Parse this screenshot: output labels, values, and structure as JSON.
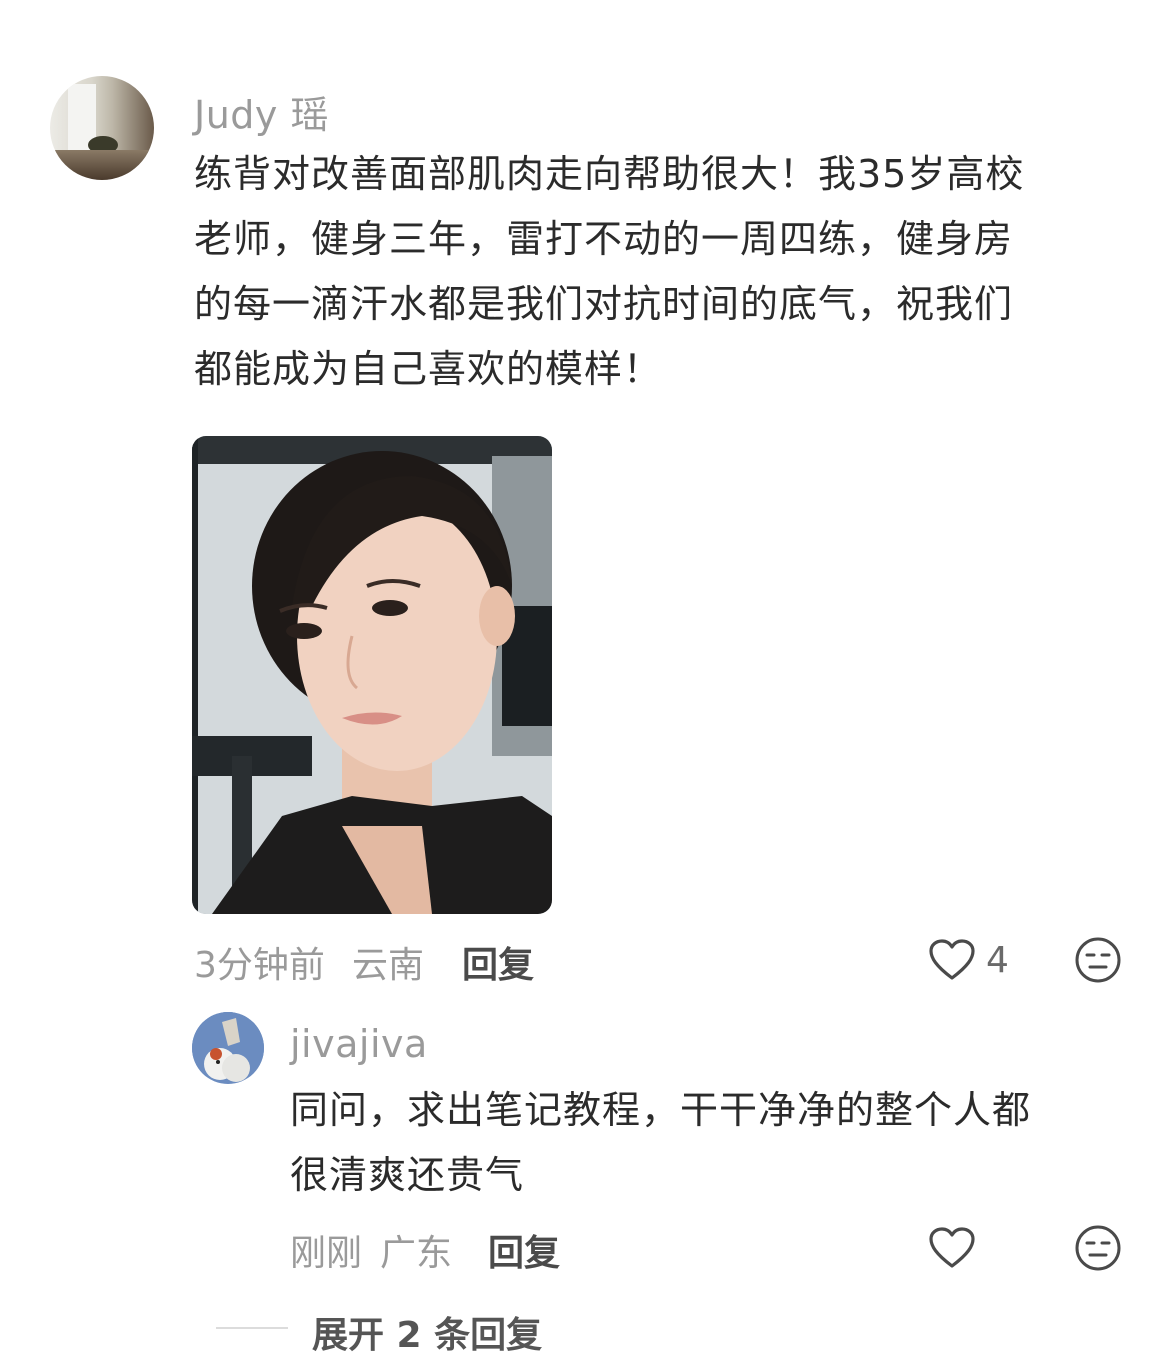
{
  "comment": {
    "username": "Judy 瑶",
    "text_lines": [
      "练背对改善面部肌肉走向帮助很大！我35岁高校",
      "老师，健身三年，雷打不动的一周四练，健身房",
      "的每一滴汗水都是我们对抗时间的底气，祝我们",
      "都能成为自己喜欢的模样！"
    ],
    "time": "3分钟前",
    "location": "云南",
    "reply_label": "回复",
    "like_count": "4"
  },
  "sub_reply": {
    "username": "jivajiva",
    "text_lines": [
      "同问，求出笔记教程，干干净净的整个人都",
      "很清爽还贵气"
    ],
    "time": "刚刚",
    "location": "广东",
    "reply_label": "回复"
  },
  "expand_label": "展开 2 条回复"
}
